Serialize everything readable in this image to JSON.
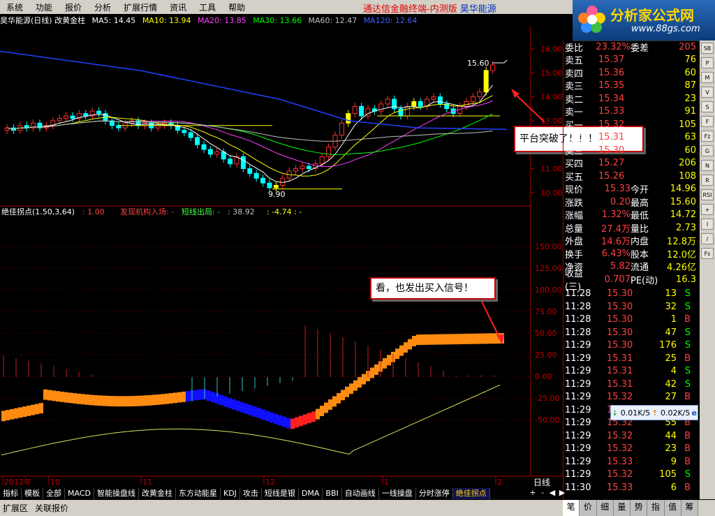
{
  "menu": {
    "items": [
      "系统",
      "功能",
      "报价",
      "分析",
      "扩展行情",
      "资讯",
      "工具",
      "帮助"
    ],
    "app_title": "通达信金融终端-内测版",
    "stock_name": "昊华能源"
  },
  "logo": {
    "text": "分析家公式网",
    "url": "www.88gs.com"
  },
  "header": {
    "title": "昊华能源(日线) 改黄金柱",
    "ma": [
      {
        "label": "MA5: 14.45",
        "color": "#ffffff"
      },
      {
        "label": "MA10: 13.94",
        "color": "#ffff00"
      },
      {
        "label": "MA20: 13.85",
        "color": "#ff40ff"
      },
      {
        "label": "MA30: 13.66",
        "color": "#00ff00"
      },
      {
        "label": "MA60: 12.47",
        "color": "#c0c0c0"
      },
      {
        "label": "MA120: 12.64",
        "color": "#4060ff"
      }
    ]
  },
  "price_axis": [
    "16.00",
    "15.00",
    "14.00",
    "13.00",
    "12.00",
    "11.00",
    "10.00"
  ],
  "price_marks": {
    "high": "15.60",
    "low": "9.90"
  },
  "indicator_header": {
    "name": "绝佳拐点(1.50,3,64)",
    "v1": ": 1.00",
    "label_buy": "发现机构入场: -",
    "label_exit": "短线出局: -",
    "v2": ": 38.92",
    "v3": ": -4.74 : -"
  },
  "ind_axis": [
    "150.00",
    "125.00",
    "100.00",
    "75.00",
    "50.00",
    "25.00",
    "0.00",
    "-25.00",
    "-50.00"
  ],
  "time_axis": [
    "2012年",
    "10",
    "11",
    "12",
    "1",
    "2"
  ],
  "annotations": {
    "breakout": "平台突破了！！！",
    "buy_signal": "看，也发出买入信号！"
  },
  "quotes": {
    "weibi": {
      "l1": "委比",
      "v1": "23.32%",
      "l2": "委差",
      "v2": "205"
    },
    "sell": [
      {
        "l": "卖五",
        "p": "15.37",
        "v": "76"
      },
      {
        "l": "卖四",
        "p": "15.36",
        "v": "60"
      },
      {
        "l": "卖三",
        "p": "15.35",
        "v": "87"
      },
      {
        "l": "卖二",
        "p": "15.34",
        "v": "23"
      },
      {
        "l": "卖一",
        "p": "15.33",
        "v": "91"
      }
    ],
    "buy": [
      {
        "l": "买一",
        "p": "15.32",
        "v": "105"
      },
      {
        "l": "买二",
        "p": "15.31",
        "v": "63"
      },
      {
        "l": "买三",
        "p": "15.30",
        "v": "60"
      },
      {
        "l": "买四",
        "p": "15.27",
        "v": "206"
      },
      {
        "l": "买五",
        "p": "15.26",
        "v": "108"
      }
    ],
    "stats": [
      {
        "l1": "现价",
        "v1": "15.33",
        "l2": "今开",
        "v2": "14.96"
      },
      {
        "l1": "涨跌",
        "v1": "0.20",
        "l2": "最高",
        "v2": "15.60"
      },
      {
        "l1": "涨幅",
        "v1": "1.32%",
        "l2": "最低",
        "v2": "14.72"
      },
      {
        "l1": "总量",
        "v1": "27.4万",
        "l2": "量比",
        "v2": "2.73"
      },
      {
        "l1": "外盘",
        "v1": "14.6万",
        "l2": "内盘",
        "v2": "12.8万"
      },
      {
        "l1": "换手",
        "v1": "6.43%",
        "l2": "股本",
        "v2": "12.0亿"
      },
      {
        "l1": "净资",
        "v1": "5.82",
        "l2": "流通",
        "v2": "4.26亿"
      },
      {
        "l1": "收益(三)",
        "v1": "0.707",
        "l2": "PE(动)",
        "v2": "16.3"
      }
    ],
    "ticks": [
      {
        "t": "11:28",
        "p": "15.30",
        "v": "13",
        "s": "S"
      },
      {
        "t": "11:28",
        "p": "15.30",
        "v": "32",
        "s": "S"
      },
      {
        "t": "11:28",
        "p": "15.30",
        "v": "1",
        "s": "B"
      },
      {
        "t": "11:28",
        "p": "15.30",
        "v": "47",
        "s": "S"
      },
      {
        "t": "11:29",
        "p": "15.30",
        "v": "176",
        "s": "S"
      },
      {
        "t": "11:29",
        "p": "15.31",
        "v": "25",
        "s": "B"
      },
      {
        "t": "11:29",
        "p": "15.31",
        "v": "4",
        "s": "S"
      },
      {
        "t": "11:29",
        "p": "15.31",
        "v": "42",
        "s": "S"
      },
      {
        "t": "11:29",
        "p": "15.32",
        "v": "27",
        "s": "B"
      },
      {
        "t": "11:29",
        "p": "15.32",
        "v": "",
        "s": ""
      },
      {
        "t": "11:29",
        "p": "15.32",
        "v": "55",
        "s": "B"
      },
      {
        "t": "11:29",
        "p": "15.32",
        "v": "44",
        "s": "B"
      },
      {
        "t": "11:29",
        "p": "15.32",
        "v": "23",
        "s": "B"
      },
      {
        "t": "11:29",
        "p": "15.33",
        "v": "9",
        "s": "B"
      },
      {
        "t": "11:29",
        "p": "15.32",
        "v": "105",
        "s": "S"
      },
      {
        "t": "11:30",
        "p": "15.33",
        "v": "6",
        "s": "B"
      }
    ]
  },
  "speed": {
    "down": "0.01K/5",
    "up": "0.02K/5"
  },
  "period": "日线",
  "bottom_tabs": [
    "指标",
    "模板",
    "全部",
    "MACD",
    "智能操盘线",
    "改黄金柱",
    "东方动能星",
    "KDJ",
    "攻击",
    "短线是银",
    "DMA",
    "BBI",
    "自动画线",
    "一线操盘",
    "分时涨停",
    "绝佳拐点"
  ],
  "footer": {
    "ext": "扩展区",
    "rel": "关联报价"
  },
  "right_tabs": [
    "笔",
    "价",
    "细",
    "量",
    "势",
    "指",
    "值",
    "筹"
  ],
  "tool_icons": [
    "SB",
    "P",
    "M",
    "V",
    "S",
    "F",
    "Fz",
    "G",
    "N",
    "R",
    "RSI",
    "+",
    "I",
    "/",
    "Fs"
  ],
  "colors": {
    "up": "#ff3030",
    "down": "#00ffff",
    "gold": "#ffff00"
  }
}
